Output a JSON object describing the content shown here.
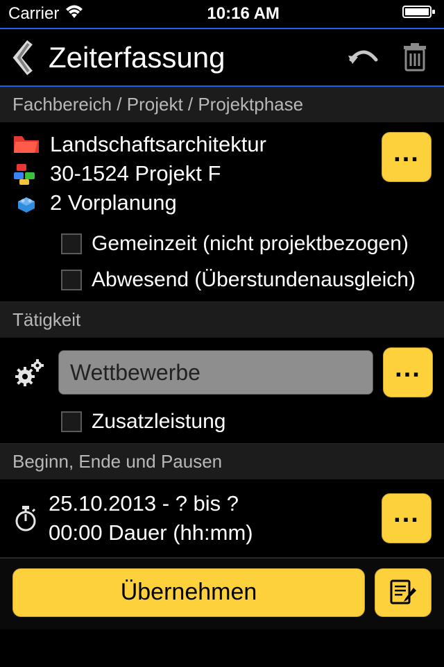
{
  "status_bar": {
    "carrier": "Carrier",
    "time": "10:16 AM"
  },
  "nav": {
    "title": "Zeiterfassung"
  },
  "sections": {
    "project": {
      "header": "Fachbereich / Projekt / Projektphase",
      "department": "Landschaftsarchitektur",
      "project": "30-1524 Projekt F",
      "phase": "2 Vorplanung",
      "checkbox_common_label": "Gemeinzeit (nicht projektbezogen)",
      "checkbox_absent_label": "Abwesend (Überstundenausgleich)"
    },
    "activity": {
      "header": "Tätigkeit",
      "value": "Wettbewerbe",
      "checkbox_additional_label": "Zusatzleistung"
    },
    "time": {
      "header": "Beginn, Ende und Pausen",
      "line1": "25.10.2013 - ? bis ?",
      "line2": "00:00 Dauer (hh:mm)"
    }
  },
  "actions": {
    "submit_label": "Übernehmen"
  },
  "colors": {
    "accent": "#fdd13b",
    "blue_rule": "#1e63e6"
  }
}
